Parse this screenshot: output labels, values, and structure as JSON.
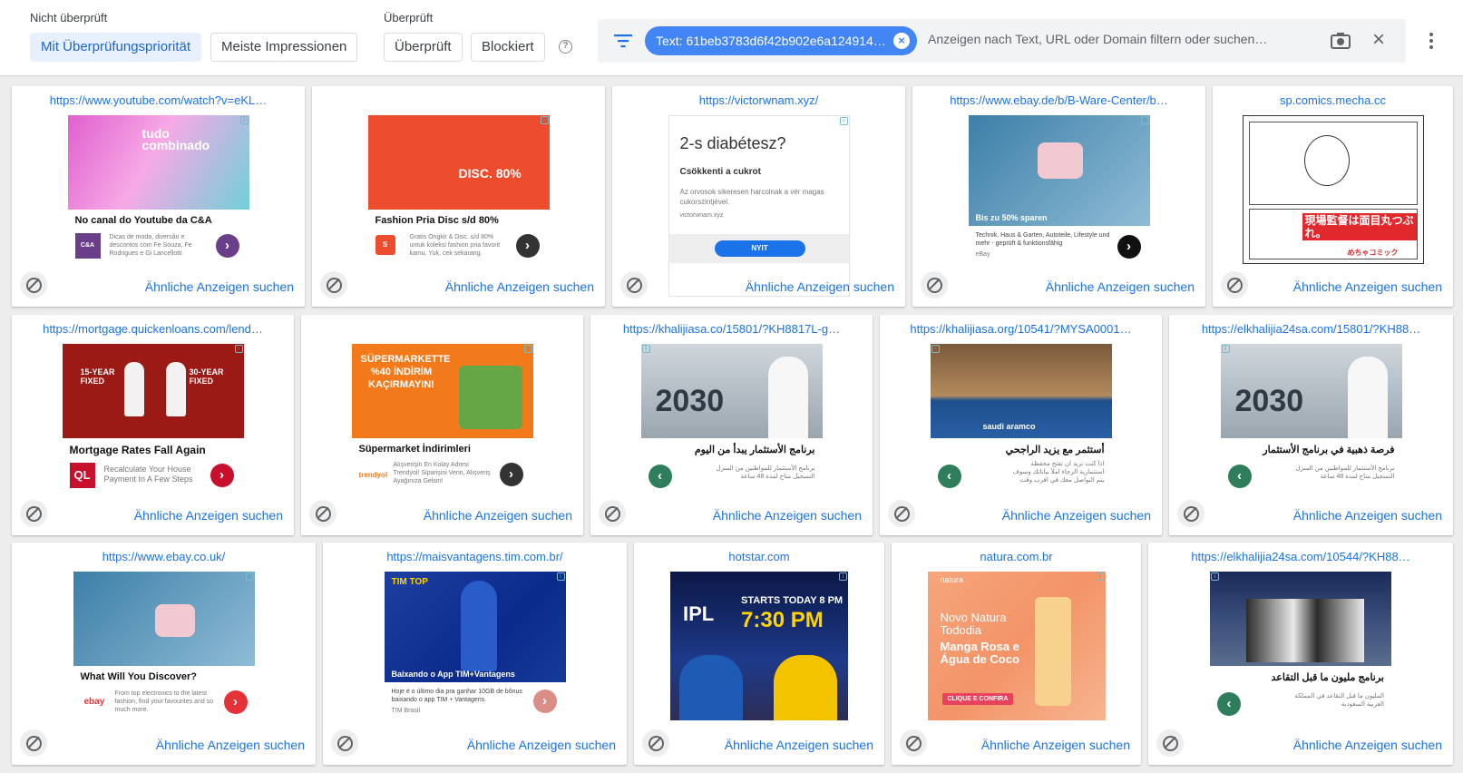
{
  "toolbar": {
    "not_reviewed_label": "Nicht überprüft",
    "reviewed_label": "Überprüft",
    "chip_priority": "Mit Überprüfungspriorität",
    "chip_impressions": "Meiste Impressionen",
    "chip_reviewed": "Überprüft",
    "chip_blocked": "Blockiert",
    "help": "?",
    "filter_chip": "Text: 61beb3783d6f42b902e6a124914…",
    "search_placeholder": "Anzeigen nach Text, URL oder Domain filtern oder suchen…",
    "accent": "#1a73e8",
    "chip_color": "#4285f4"
  },
  "common": {
    "similar": "Ähnliche Anzeigen suchen"
  },
  "cards": [
    {
      "url": "https://www.youtube.com/watch?v=eKL…",
      "title": "No canal do Youtube da C&A",
      "overlay": "tudo combinado",
      "desc": "Dicas de moda, diversão e descontos com Fe Souza, Fe Rodrigues e Gi Lancellotti",
      "logo": "C&A"
    },
    {
      "url": "",
      "title": "Fashion Pria Disc s/d 80%",
      "overlay": "DISC. 80%",
      "desc": "Gratis Ongkir & Disc. s/d 80% untuk koleksi fashion pria favorit kamu. Yuk, cek sekarang."
    },
    {
      "url": "https://victorwnam.xyz/",
      "headline": "2-s diabétesz?",
      "sub": "Csökkenti a cukrot",
      "desc": "Az orvosok sikeresen harcolnak a vér magas cukorszintjével.",
      "domain": "victorwnam.xyz",
      "cta": "NYIT"
    },
    {
      "url": "https://www.ebay.de/b/B-Ware-Center/b…",
      "overlay": "Bis zu 50% sparen",
      "desc": "Technik, Haus & Garten, Autoteile, Lifestyle und mehr - geprüft & funktionsfähig",
      "brand": "eBay"
    },
    {
      "url": "sp.comics.mecha.cc",
      "overlay": "現場監督は面目丸つぶれ。",
      "brand": "めちゃコミック"
    },
    {
      "url": "https://mortgage.quickenloans.com/lend…",
      "title": "Mortgage Rates Fall Again",
      "overlay_a": "15-YEAR FIXED",
      "overlay_b": "30-YEAR FIXED",
      "desc": "Recalculate Your House Payment In A Few Steps",
      "logo": "QL"
    },
    {
      "url": "",
      "title": "Süpermarket İndirimleri",
      "overlay": "SÜPERMARKETTE %40 İNDİRİM KAÇIRMAYIN!",
      "desc": "Alışverişin En Kolay Adresi Trendyol! Siparişini Verin, Alışveriş Ayağınıza Gelsin!",
      "logo": "trendyol"
    },
    {
      "url": "https://khalijiasa.co/15801/?KH8817L-g…",
      "title": "برنامج الأستثمار يبدأ من اليوم",
      "overlay": "2030",
      "desc": "برنامج الأستثمار للمواطنين من المنزل التسجيل متاح لمدة 48 ساعة"
    },
    {
      "url": "https://khalijiasa.org/10541/?MYSA0001…",
      "title": "أستثمر مع يزيد الراجحي",
      "overlay": "saudi aramco",
      "desc": "اذا كنت تريد ان تفتح محفظة استثمارية الرجاء املأ بياناتك وسوف يتم التواصل معك في اقرب وقت"
    },
    {
      "url": "https://elkhalijia24sa.com/15801/?KH88…",
      "title": "فرصة ذهبية في برنامج الأستثمار",
      "overlay": "2030",
      "desc": "برنامج الأستثمار للمواطنين من المنزل التسجيل متاح لمدة 48 ساعة"
    },
    {
      "url": "https://www.ebay.co.uk/",
      "title": "What Will You Discover?",
      "desc": "From top electronics to the latest fashion, find your favourites and so much more.",
      "logo": "ebay"
    },
    {
      "url": "https://maisvantagens.tim.com.br/",
      "overlay": "Baixando o App TIM+Vantagens",
      "desc": "Hoje é o último dia pra ganhar 10GB de bônus baixando o app TIM + Vantagens.",
      "brand": "TIM Brasil"
    },
    {
      "url": "hotstar.com",
      "overlay_a": "STARTS TODAY 8 PM",
      "overlay_b": "7:30 PM",
      "overlay_c": "IPL"
    },
    {
      "url": "natura.com.br",
      "overlay_a": "Novo Natura Tododia",
      "overlay_b": "Manga Rosa e Água de Coco",
      "cta": "CLIQUE E CONFIRA",
      "brand": "natura"
    },
    {
      "url": "https://elkhalijia24sa.com/10544/?KH88…",
      "title": "برنامج مليون ما قبل التقاعد",
      "desc": "المليون ما قبل التقاعد في المملكة العربية السعودية"
    }
  ]
}
